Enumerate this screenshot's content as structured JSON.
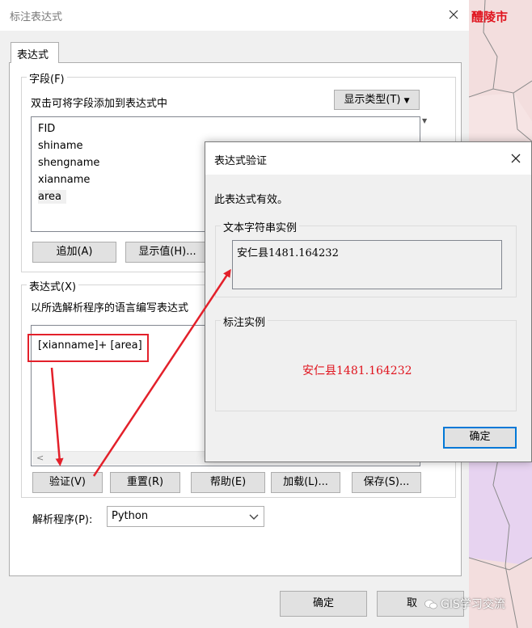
{
  "map": {
    "label": "醴陵市"
  },
  "main_window": {
    "title": "标注表达式",
    "tab_label": "表达式",
    "fields_group": {
      "legend": "字段(F)",
      "hint": "双击可将字段添加到表达式中",
      "show_type_button": "显示类型(T)",
      "fields": [
        "FID",
        "shiname",
        "shengname",
        "xianname",
        "area"
      ],
      "add_button": "追加(A)",
      "show_values_button": "显示值(H)..."
    },
    "expression_group": {
      "legend": "表达式(X)",
      "hint": "以所选解析程序的语言编写表达式",
      "expression_text": "[xianname]+ [area]",
      "verify_button": "验证(V)",
      "reset_button": "重置(R)",
      "help_button": "帮助(E)",
      "load_button": "加载(L)...",
      "save_button": "保存(S)..."
    },
    "parser_label": "解析程序(P):",
    "parser_value": "Python",
    "ok_button": "确定",
    "cancel_button": "取"
  },
  "verify_dialog": {
    "title": "表达式验证",
    "message": "此表达式有效。",
    "text_sample_legend": "文本字符串实例",
    "text_sample_value": "安仁县1481.164232",
    "label_sample_legend": "标注实例",
    "label_sample_value": "安仁县1481.164232",
    "label_sample_color": "#e0141e",
    "ok_button": "确定"
  },
  "watermark": "GIS学习交流",
  "colors": {
    "accent": "#0078d7",
    "annotation_red": "#e3202a"
  }
}
